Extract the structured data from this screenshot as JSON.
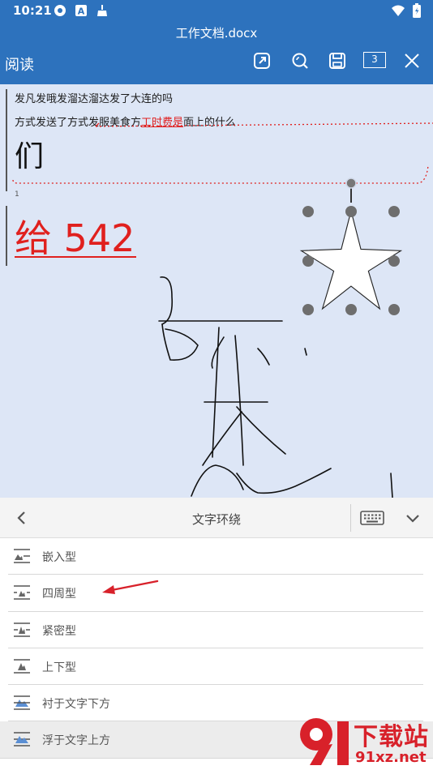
{
  "status_bar": {
    "time": "10:21"
  },
  "title_bar": {
    "document_title": "工作文档.docx",
    "mode_label": "阅读",
    "page_count": "3"
  },
  "document": {
    "line1": "发凡发哦发溜达溜达发了大连的吗",
    "line2_prefix": "方式发送了方式发服美食方",
    "line2_highlight": "工时费是",
    "line2_suffix": "面上的什么",
    "big_char": "们",
    "small_num": "1",
    "huge_text": "给 542"
  },
  "panel": {
    "title": "文字环绕",
    "options": [
      {
        "label": "嵌入型"
      },
      {
        "label": "四周型"
      },
      {
        "label": "紧密型"
      },
      {
        "label": "上下型"
      },
      {
        "label": "衬于文字下方"
      },
      {
        "label": "浮于文字上方"
      }
    ]
  },
  "watermark": {
    "brand": "下载站",
    "url": "91xz.net"
  },
  "colors": {
    "primary": "#2d72bd",
    "doc_bg": "#dde6f6",
    "accent_red": "#e0201e"
  }
}
